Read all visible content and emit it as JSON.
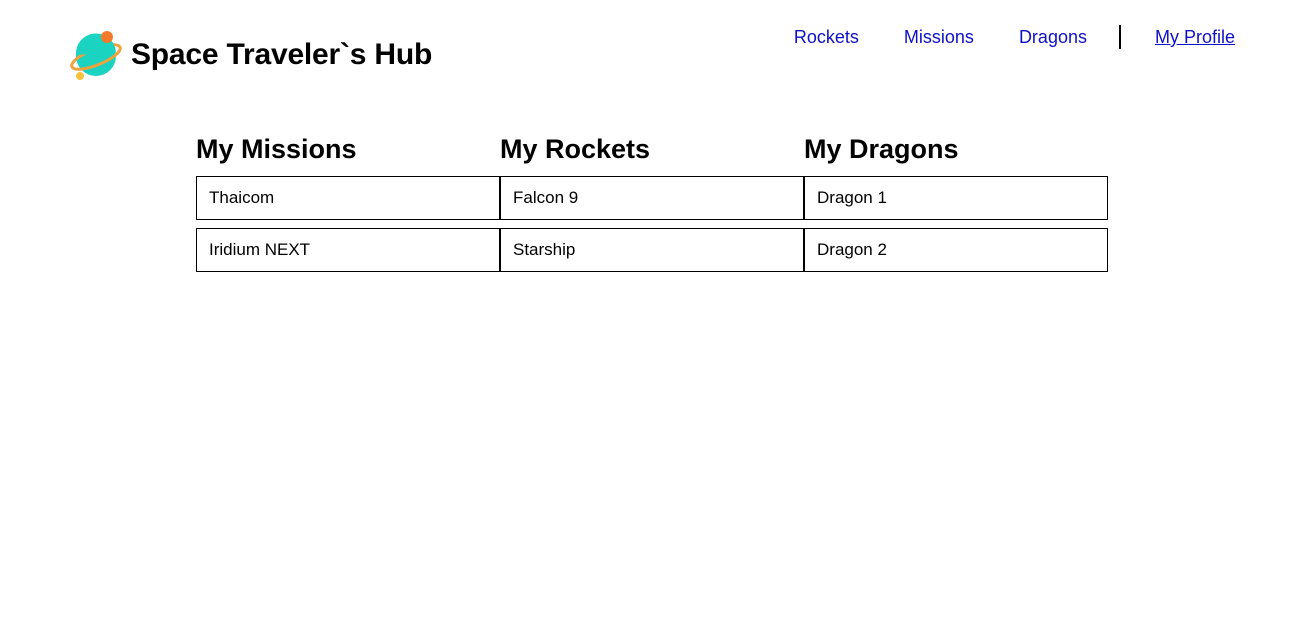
{
  "header": {
    "app_title": "Space Traveler`s Hub",
    "logo_icon": "planet-icon",
    "nav": {
      "rockets": "Rockets",
      "missions": "Missions",
      "dragons": "Dragons",
      "profile": "My Profile"
    },
    "link_color": "#1010c8"
  },
  "profile": {
    "missions": {
      "heading": "My Missions",
      "items": [
        "Thaicom",
        "Iridium NEXT"
      ]
    },
    "rockets": {
      "heading": "My Rockets",
      "items": [
        "Falcon 9",
        "Starship"
      ]
    },
    "dragons": {
      "heading": "My Dragons",
      "items": [
        "Dragon 1",
        "Dragon 2"
      ]
    }
  }
}
